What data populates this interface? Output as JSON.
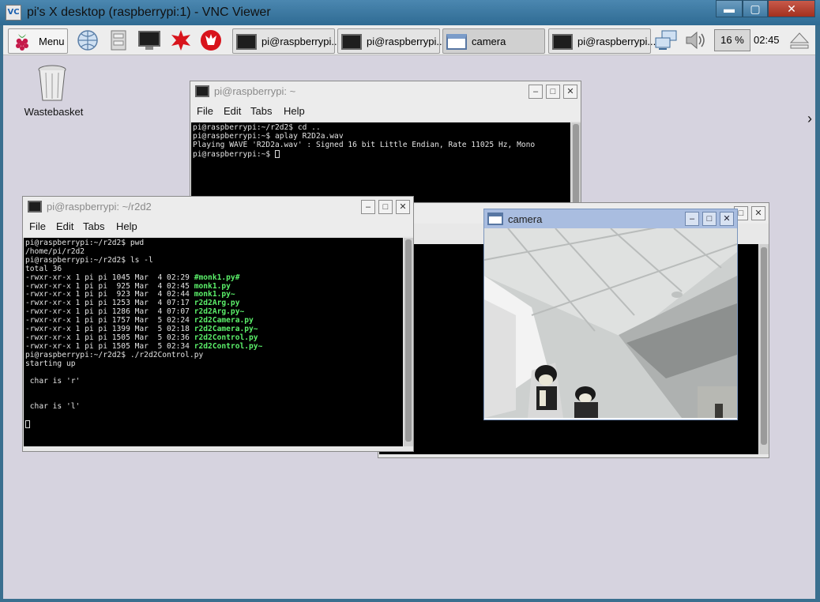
{
  "vnc": {
    "title": "pi's X desktop (raspberrypi:1) - VNC Viewer",
    "logo": "VC",
    "min": "▬",
    "max": "▢",
    "close": "✕"
  },
  "taskbar": {
    "menu_label": "Menu",
    "tasks": [
      {
        "label": "pi@raspberrypi..."
      },
      {
        "label": "pi@raspberrypi..."
      },
      {
        "label": "camera"
      },
      {
        "label": "pi@raspberrypi..."
      }
    ],
    "cpu": "16 %",
    "clock": "02:45"
  },
  "desktop": {
    "wastebasket_label": "Wastebasket",
    "arrow": "›"
  },
  "term_back": {
    "title": "pi@raspberrypi: ~",
    "menus": [
      "File",
      "Edit",
      "Tabs",
      "Help"
    ],
    "lines": [
      "pi@raspberrypi:~/r2d2$ cd ..",
      "pi@raspberrypi:~$ aplay R2D2a.wav",
      "Playing WAVE 'R2D2a.wav' : Signed 16 bit Little Endian, Rate 11025 Hz, Mono",
      "pi@raspberrypi:~$ "
    ]
  },
  "term_front": {
    "title": "pi@raspberrypi: ~/r2d2",
    "menus": [
      "File",
      "Edit",
      "Tabs",
      "Help"
    ],
    "lines_top": [
      "pi@raspberrypi:~/r2d2$ pwd",
      "/home/pi/r2d2",
      "pi@raspberrypi:~/r2d2$ ls -l",
      "total 36"
    ],
    "files": [
      {
        "perm": "-rwxr-xr-x 1 pi pi 1045 Mar  4 02:29 ",
        "name": "#monk1.py#"
      },
      {
        "perm": "-rwxr-xr-x 1 pi pi  925 Mar  4 02:45 ",
        "name": "monk1.py"
      },
      {
        "perm": "-rwxr-xr-x 1 pi pi  923 Mar  4 02:44 ",
        "name": "monk1.py~"
      },
      {
        "perm": "-rwxr-xr-x 1 pi pi 1253 Mar  4 07:17 ",
        "name": "r2d2Arg.py"
      },
      {
        "perm": "-rwxr-xr-x 1 pi pi 1286 Mar  4 07:07 ",
        "name": "r2d2Arg.py~"
      },
      {
        "perm": "-rwxr-xr-x 1 pi pi 1757 Mar  5 02:24 ",
        "name": "r2d2Camera.py"
      },
      {
        "perm": "-rwxr-xr-x 1 pi pi 1399 Mar  5 02:18 ",
        "name": "r2d2Camera.py~"
      },
      {
        "perm": "-rwxr-xr-x 1 pi pi 1505 Mar  5 02:36 ",
        "name": "r2d2Control.py"
      },
      {
        "perm": "-rwxr-xr-x 1 pi pi 1505 Mar  5 02:34 ",
        "name": "r2d2Control.py~"
      }
    ],
    "lines_bottom": [
      "pi@raspberrypi:~/r2d2$ ./r2d2Control.py",
      "starting up",
      "",
      " char is 'r'",
      "",
      "",
      " char is 'l'",
      ""
    ]
  },
  "camera": {
    "title": "camera"
  },
  "window_buttons": {
    "min": "–",
    "max": "□",
    "close": "✕"
  }
}
